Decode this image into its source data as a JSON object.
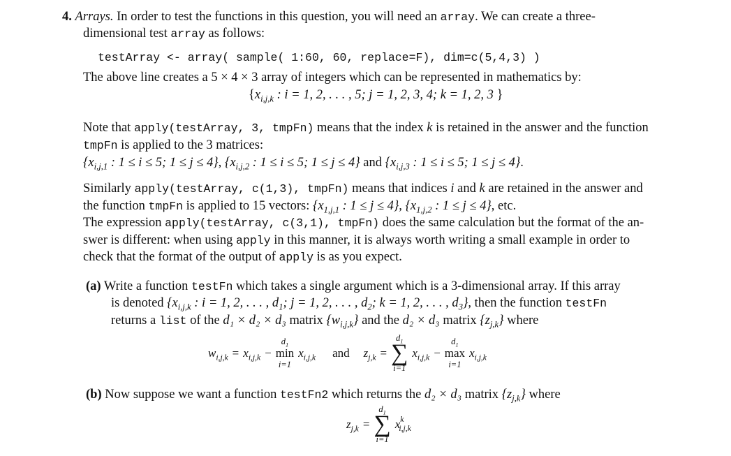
{
  "question": {
    "number": "4.",
    "title": "Arrays.",
    "intro_1": " In order to test the functions in this question, you will need an ",
    "intro_code": "array",
    "intro_2": ".  We can create a three-",
    "intro_line2": "dimensional test ",
    "intro_line2_code": "array",
    "intro_line2_end": " as follows:",
    "code_line": "testArray <- array( sample( 1:60, 60, replace=F), dim=c(5,4,3) )",
    "above_line": "The above line creates a 5 × 4 × 3 array of integers which can be represented in mathematics by:",
    "set_notation": {
      "open": "{",
      "var": "x",
      "sub": "i,j,k",
      "body": " : i = 1, 2, . . . , 5;  j = 1, 2, 3, 4;  k = 1, 2, 3 ",
      "close": "}"
    }
  },
  "note": {
    "p1_a": "Note that ",
    "p1_code": "apply(testArray, 3, tmpFn)",
    "p1_b": " means that the index ",
    "p1_k": "k",
    "p1_c": " is retained in the answer and the function",
    "p2_code": "tmpFn",
    "p2_b": " is applied to the 3 matrices:",
    "p3_m1_sub": "i,j,1",
    "p3_m2_sub": "i,j,2",
    "p3_m3_sub": "i,j,3",
    "p3_cond": " : 1 ≤ i ≤ 5; 1 ≤ j ≤ 4",
    "p3_and": " and ",
    "p3_end": "."
  },
  "similarly": {
    "l1_a": "Similarly ",
    "l1_code": "apply(testArray, c(1,3), tmpFn)",
    "l1_b": " means that indices ",
    "l1_i": "i",
    "l1_c": " and ",
    "l1_k": "k",
    "l1_d": " are retained in the answer and",
    "l2_a": "the function ",
    "l2_code": "tmpFn",
    "l2_b": " is applied to 15 vectors: ",
    "l2_v1_sub": "1,j,1",
    "l2_v2_sub": "1,j,2",
    "l2_cond": " : 1 ≤ j ≤ 4",
    "l2_end": ", etc.",
    "l3_a": "The expression ",
    "l3_code": "apply(testArray, c(3,1), tmpFn)",
    "l3_b": " does the same calculation but the format of the an-",
    "l4_a": "swer is different: when using ",
    "l4_code": "apply",
    "l4_b": " in this manner, it is always worth writing a small example in order to",
    "l5_a": "check that the format of the output of ",
    "l5_code": "apply",
    "l5_b": " is as you expect."
  },
  "part_a": {
    "label": "(a)",
    "l1_a": "Write a function ",
    "l1_code": "testFn",
    "l1_b": " which takes a single argument which is a 3-dimensional array. If this array",
    "l2_a": "is denoted ",
    "l2_set": ": i = 1, 2, . . . , d",
    "l2_set2": "; j = 1, 2, . . . , d",
    "l2_set3": "; k = 1, 2, . . . , d",
    "l2_b": ", then the function ",
    "l2_code": "testFn",
    "l3_a": "returns a ",
    "l3_code": "list",
    "l3_b": " of the ",
    "l3_dims3": "d₁ × d₂ × d₃",
    "l3_c": " matrix ",
    "l3_w_sub": "i,j,k",
    "l3_d": " and the ",
    "l3_dims2": "d₂ × d₃",
    "l3_e": " matrix ",
    "l3_z_sub": "j,k",
    "l3_f": " where",
    "eq_w_lhs_sub": "i,j,k",
    "eq_op_min": "min",
    "eq_op_max": "max",
    "eq_upper": "d",
    "eq_upper_sub": "1",
    "eq_lower": "i=1",
    "eq_and": "and",
    "eq_z_lhs_sub": "j,k",
    "eq_x_sub": "i,j,k",
    "eq_sum": "∑"
  },
  "part_b": {
    "label": "(b)",
    "l1_a": " Now suppose we want a function ",
    "l1_code": "testFn2",
    "l1_b": " which returns the ",
    "l1_dims": "d₂ × d₃",
    "l1_c": " matrix ",
    "l1_z_sub": "j,k",
    "l1_d": " where",
    "eq_lhs_sub": "j,k",
    "eq_sum": "∑",
    "eq_upper": "d",
    "eq_upper_sub": "1",
    "eq_lower": "i=1",
    "eq_x_sup": "k",
    "eq_x_sub": "i,j,k"
  }
}
